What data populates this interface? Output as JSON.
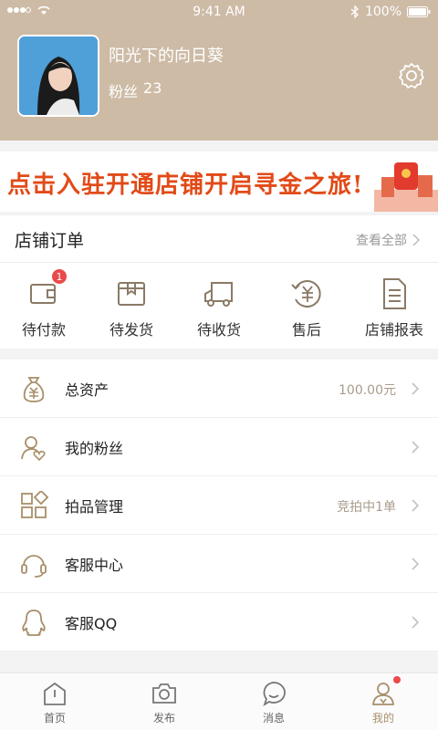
{
  "status": {
    "time": "9:41 AM",
    "battery": "100%"
  },
  "profile": {
    "username": "阳光下的向日葵",
    "fans_label": "粉丝",
    "fans_count": "23"
  },
  "banner": {
    "text": "点击入驻开通店铺开启寻金之旅!"
  },
  "orders": {
    "title": "店铺订单",
    "view_all": "查看全部",
    "items": [
      {
        "label": "待付款",
        "icon": "wallet-icon",
        "badge": "1"
      },
      {
        "label": "待发货",
        "icon": "box-icon"
      },
      {
        "label": "待收货",
        "icon": "truck-icon"
      },
      {
        "label": "售后",
        "icon": "refund-icon"
      },
      {
        "label": "店铺报表",
        "icon": "report-icon"
      }
    ]
  },
  "menu": [
    {
      "label": "总资产",
      "value": "100.00元",
      "icon": "money-bag-icon"
    },
    {
      "label": "我的粉丝",
      "value": "",
      "icon": "fans-icon"
    },
    {
      "label": "拍品管理",
      "value": "竞拍中1单",
      "icon": "grid-icon"
    },
    {
      "label": "客服中心",
      "value": "",
      "icon": "headset-icon"
    },
    {
      "label": "客服QQ",
      "value": "",
      "icon": "qq-icon"
    }
  ],
  "tabs": [
    {
      "label": "首页",
      "icon": "home-icon"
    },
    {
      "label": "发布",
      "icon": "camera-icon"
    },
    {
      "label": "消息",
      "icon": "message-icon"
    },
    {
      "label": "我的",
      "icon": "user-icon",
      "active": true
    }
  ],
  "colors": {
    "header_bg": "#cdbba6",
    "accent": "#a88f6a",
    "badge": "#e94a4a",
    "banner_text": "#e24a17"
  }
}
